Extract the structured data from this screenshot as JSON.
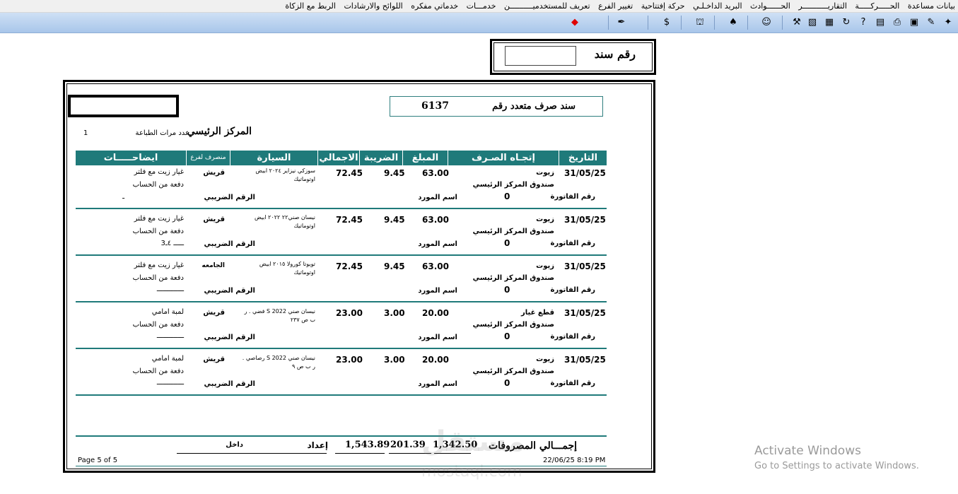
{
  "menu": [
    "بيانات مساعدة",
    "الحـــــركـــــة",
    "التقاريـــــــــــر",
    "الحــــــوادث",
    "البريد الداخـلـي",
    "حركة إفتتاحية",
    "تغيير الفرع",
    "تعريف للمستخدميــــــــــن",
    "خدمـــات",
    "خدماتي مفكره",
    "اللوائح والارشادات",
    "الربط مع الزكاة"
  ],
  "toolbar_icons": [
    "new-icon",
    "edit-icon",
    "clear-icon",
    "print-icon",
    "export-icon",
    "help-icon",
    "refresh-icon",
    "calendar-icon",
    "notes-icon",
    "tools-icon",
    "users-icon",
    "spade-icon",
    "branch-icon",
    "money-icon",
    "pen-icon",
    "stop-icon"
  ],
  "sanad": {
    "label": "رقم سند",
    "value": ""
  },
  "report": {
    "title": "سند صرف متعدد رقم",
    "number": "6137",
    "center": "المركز الرئيسي",
    "print_count_label": "عدد مرات الطباعة",
    "print_count": "1",
    "headers": [
      "التاريخ",
      "إتجـاه الصـرف",
      "المبلغ",
      "الضريبة",
      "الاجمالي",
      "السيارة",
      "منصرف لفرع",
      "ايضاحـــــات"
    ],
    "rows": [
      {
        "date": "31/05/25",
        "type": "زيوت",
        "fund": "صندوق المركز الرئيسي",
        "invoice_label": "رقم الفاتورة",
        "invoice": "0",
        "supplier_label": "اسم المورد",
        "amount": "63.00",
        "tax": "9.45",
        "total": "72.45",
        "car": "سوزكي نيزاير ٢٠٢٤ ابيض",
        "car2": "اوتوماتيك",
        "branch": "قريش",
        "desc": "غيار زيت مع فلتر",
        "pay": "دفعة من الحساب",
        "tax_no_label": "الرقم الضريبي",
        "acct": "ـ"
      },
      {
        "date": "31/05/25",
        "type": "زيوت",
        "fund": "صندوق المركز الرئيسي",
        "invoice_label": "رقم الفاتورة",
        "invoice": "0",
        "supplier_label": "اسم المورد",
        "amount": "63.00",
        "tax": "9.45",
        "total": "72.45",
        "car": "نيسان صني٢٢ ٢٠٢٢ ابيض",
        "car2": "اوتوماتيك",
        "branch": "قريش",
        "desc": "غيار زيت مع فلتر",
        "pay": "دفعة من الحساب",
        "tax_no_label": "الرقم الضريبي",
        "acct": "3ـــــ ٤ـ"
      },
      {
        "date": "31/05/25",
        "type": "زيوت",
        "fund": "صندوق المركز الرئيسي",
        "invoice_label": "رقم الفاتورة",
        "invoice": "0",
        "supplier_label": "اسم المورد",
        "amount": "63.00",
        "tax": "9.45",
        "total": "72.45",
        "car": "تويوتا كورولا ٢٠١٥ ابيض",
        "car2": "اوتوماتيك",
        "branch": "الجامعه",
        "desc": "غيار زيت مع فلتر",
        "pay": "دفعة من الحساب",
        "tax_no_label": "الرقم الضريبي",
        "acct": "ـــــــــــــ"
      },
      {
        "date": "31/05/25",
        "type": "قطع غيار",
        "fund": "صندوق المركز الرئيسي",
        "invoice_label": "رقم الفاتورة",
        "invoice": "0",
        "supplier_label": "اسم المورد",
        "amount": "20.00",
        "tax": "3.00",
        "total": "23.00",
        "car": "فضي . ر S نيسان صني 2022",
        "car2": "ب ص ٢٣٧",
        "branch": "قريش",
        "desc": "لمبة امامي",
        "pay": "دفعة من الحساب",
        "tax_no_label": "الرقم الضريبي",
        "acct": "ـــــــــــــ"
      },
      {
        "date": "31/05/25",
        "type": "زيوت",
        "fund": "صندوق المركز الرئيسي",
        "invoice_label": "رقم الفاتورة",
        "invoice": "0",
        "supplier_label": "اسم المورد",
        "amount": "20.00",
        "tax": "3.00",
        "total": "23.00",
        "car": ". رصاصي S نيسان صني 2022",
        "car2": "ر ب ص ٩",
        "branch": "قريش",
        "desc": "لمبة امامي",
        "pay": "دفعة من الحساب",
        "tax_no_label": "الرقم الضريبي",
        "acct": "ـــــــــــــ"
      }
    ],
    "totals": {
      "label": "إجمـــالي المصروفات",
      "amount": "1,342.50",
      "tax": "201.39",
      "total": "1,543.89",
      "prepared_label": "إعداد",
      "entry_label": "داخل"
    },
    "page": "Page 5 of 5",
    "printed": "22/06/25  8:19 PM"
  },
  "watermark": {
    "main": "مستقل",
    "sub": "mostaql.com"
  },
  "activation": {
    "line1": "Activate Windows",
    "line2": "Go to Settings to activate Windows."
  }
}
